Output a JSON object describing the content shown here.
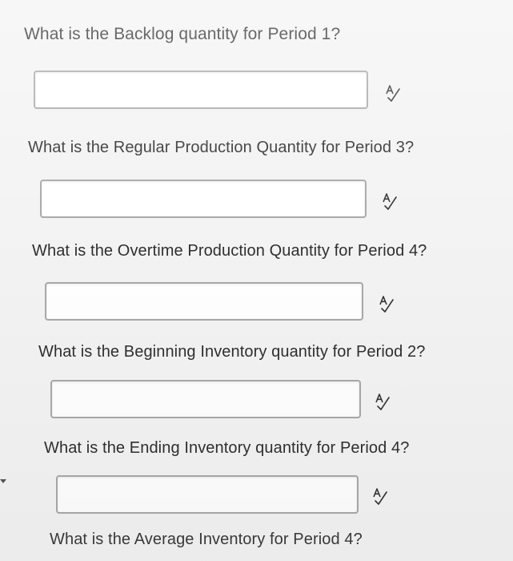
{
  "questions": [
    {
      "text": "What is the Backlog quantity for Period 1?",
      "answer": "",
      "icon": "spell-check-icon"
    },
    {
      "text": "What is the Regular Production Quantity for Period 3?",
      "answer": "",
      "icon": "spell-check-icon"
    },
    {
      "text": "What is the Overtime Production Quantity for Period 4?",
      "answer": "",
      "icon": "spell-check-icon"
    },
    {
      "text": "What is the Beginning Inventory quantity for Period 2?",
      "answer": "",
      "icon": "spell-check-icon"
    },
    {
      "text": "What is the Ending Inventory quantity for Period 4?",
      "answer": "",
      "icon": "spell-check-icon"
    },
    {
      "text": "What is the Average Inventory for Period 4?"
    }
  ]
}
